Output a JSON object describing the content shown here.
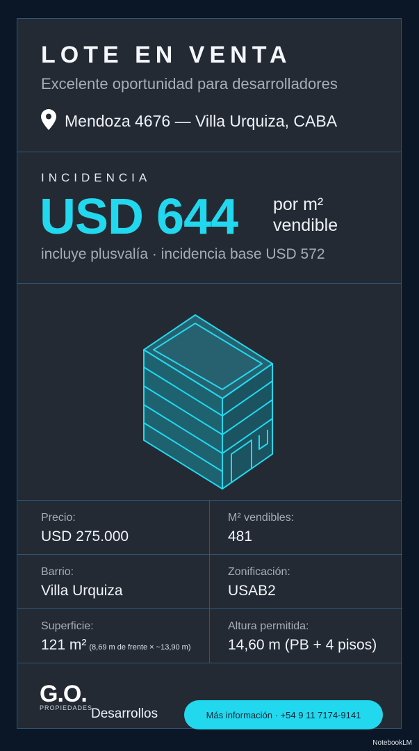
{
  "header": {
    "title": "LOTE EN VENTA",
    "subtitle": "Excelente oportunidad para desarrolladores",
    "location": "Mendoza 4676 — Villa Urquiza, CABA",
    "location_icon": "map-pin-icon"
  },
  "incidencia": {
    "label": "INCIDENCIA",
    "value": "USD 644",
    "unit_line1": "por m²",
    "unit_line2": "vendible",
    "note": "incluye plusvalía · incidencia base USD 572"
  },
  "illustration": {
    "icon": "building-isometric-icon"
  },
  "details": {
    "precio": {
      "label": "Precio:",
      "value": "USD 275.000"
    },
    "m2_vendibles": {
      "label": "M² vendibles:",
      "value": "481"
    },
    "barrio": {
      "label": "Barrio:",
      "value": "Villa Urquiza"
    },
    "zonificacion": {
      "label": "Zonificación:",
      "value": "USAB2"
    },
    "superficie": {
      "label": "Superficie:",
      "value": "121 m²",
      "detail": "(8,69 m de frente × ~13,90 m)"
    },
    "altura": {
      "label": "Altura permitida:",
      "value": "14,60 m (PB + 4 pisos)"
    }
  },
  "footer": {
    "logo_text": "G.O.",
    "logo_sub": "PROPIEDADES",
    "brand": "Desarrollos",
    "cta": "Más información · +54 9 11 7174-9141"
  },
  "watermark": "NotebookLM",
  "colors": {
    "accent": "#22d8ee",
    "card": "#242a33",
    "background": "#0b1627",
    "border": "#2f5577"
  }
}
